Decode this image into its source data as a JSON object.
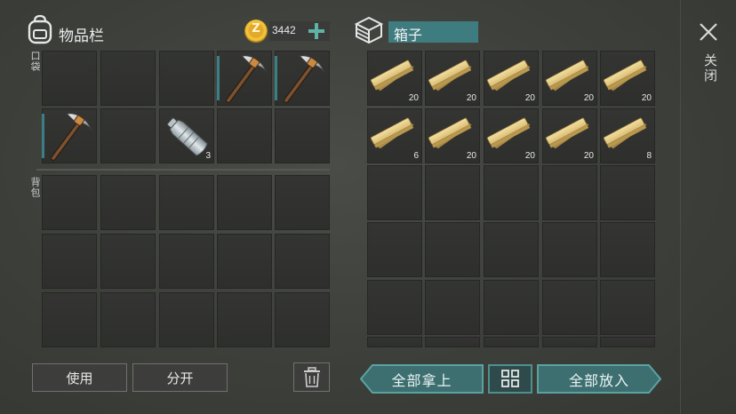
{
  "header": {
    "inventory_title": "物品栏",
    "coins": "3442",
    "coin_symbol": "Z",
    "box_name": "箱子",
    "close_label": "关闭"
  },
  "pocket": {
    "label": "口袋",
    "slots": [
      {
        "item": "",
        "count": ""
      },
      {
        "item": "",
        "count": ""
      },
      {
        "item": "",
        "count": ""
      },
      {
        "item": "pickaxe",
        "count": ""
      },
      {
        "item": "pickaxe",
        "count": ""
      },
      {
        "item": "pickaxe",
        "count": ""
      },
      {
        "item": "",
        "count": ""
      },
      {
        "item": "plastic-bottle",
        "count": "3"
      },
      {
        "item": "",
        "count": ""
      },
      {
        "item": "",
        "count": ""
      }
    ]
  },
  "backpack": {
    "label": "背包"
  },
  "box": {
    "slots": [
      {
        "item": "wood-plank",
        "count": "20"
      },
      {
        "item": "wood-plank",
        "count": "20"
      },
      {
        "item": "wood-plank",
        "count": "20"
      },
      {
        "item": "wood-plank",
        "count": "20"
      },
      {
        "item": "wood-plank",
        "count": "20"
      },
      {
        "item": "wood-plank",
        "count": "6"
      },
      {
        "item": "wood-plank",
        "count": "20"
      },
      {
        "item": "wood-plank",
        "count": "20"
      },
      {
        "item": "wood-plank",
        "count": "20"
      },
      {
        "item": "wood-plank",
        "count": "8"
      }
    ]
  },
  "buttons": {
    "use": "使用",
    "split": "分开",
    "take_all": "全部拿上",
    "put_all": "全部放入"
  },
  "icons": {
    "backpack": "backpack-icon",
    "add": "plus-icon",
    "box": "box-icon",
    "close": "close-icon",
    "trash": "trash-icon",
    "sort": "grid-sort-icon"
  },
  "colors": {
    "accent_teal": "#4d8f8e",
    "box_name_bg": "#3f7c80",
    "slot_marker": "#3b7f86",
    "coin": "#e0ad2a"
  }
}
